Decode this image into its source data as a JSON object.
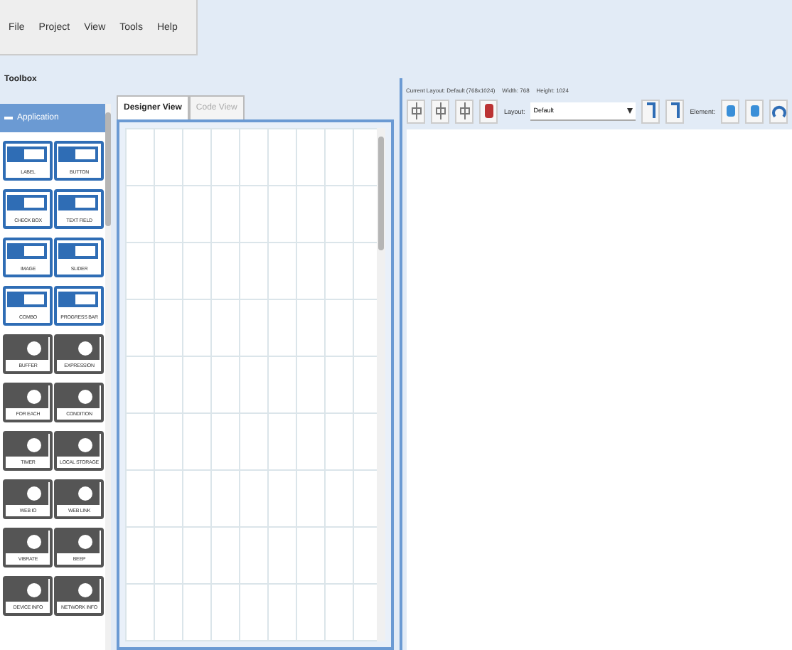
{
  "menu": [
    "File",
    "Project",
    "View",
    "Tools",
    "Help"
  ],
  "toolbox": {
    "title": "Toolbox",
    "section": {
      "label": "Application",
      "expanded": true
    },
    "items": [
      {
        "label": "LABEL",
        "kind": "control"
      },
      {
        "label": "BUTTON",
        "kind": "control"
      },
      {
        "label": "CHECK BOX",
        "kind": "control"
      },
      {
        "label": "TEXT FIELD",
        "kind": "control"
      },
      {
        "label": "IMAGE",
        "kind": "control"
      },
      {
        "label": "SLIDER",
        "kind": "control"
      },
      {
        "label": "COMBO",
        "kind": "control"
      },
      {
        "label": "PROGRESS BAR",
        "kind": "control"
      },
      {
        "label": "BUFFER",
        "kind": "logic"
      },
      {
        "label": "EXPRESSION",
        "kind": "logic"
      },
      {
        "label": "FOR EACH",
        "kind": "logic"
      },
      {
        "label": "CONDITION",
        "kind": "logic"
      },
      {
        "label": "TIMER",
        "kind": "logic"
      },
      {
        "label": "LOCAL STORAGE",
        "kind": "logic"
      },
      {
        "label": "WEB IO",
        "kind": "logic"
      },
      {
        "label": "WEB LINK",
        "kind": "logic"
      },
      {
        "label": "VIBRATE",
        "kind": "logic"
      },
      {
        "label": "BEEP",
        "kind": "logic"
      },
      {
        "label": "DEVICE INFO",
        "kind": "logic"
      },
      {
        "label": "NETWORK INFO",
        "kind": "logic"
      }
    ]
  },
  "tabs": [
    {
      "label": "Designer View",
      "selected": true
    },
    {
      "label": "Code View",
      "selected": false
    }
  ],
  "layout_info": {
    "current": "Current Layout: Default (768x1024)",
    "width": "Width: 768",
    "height": "Height: 1024"
  },
  "layout_select": {
    "label": "Layout:",
    "value": "Default"
  },
  "element_label": "Element:"
}
